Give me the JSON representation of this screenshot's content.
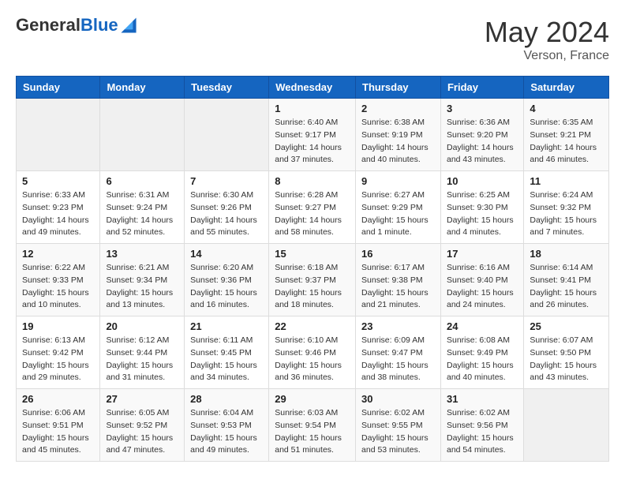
{
  "logo": {
    "general": "General",
    "blue": "Blue"
  },
  "header": {
    "month": "May 2024",
    "location": "Verson, France"
  },
  "weekdays": [
    "Sunday",
    "Monday",
    "Tuesday",
    "Wednesday",
    "Thursday",
    "Friday",
    "Saturday"
  ],
  "weeks": [
    [
      {
        "day": "",
        "sunrise": "",
        "sunset": "",
        "daylight": ""
      },
      {
        "day": "",
        "sunrise": "",
        "sunset": "",
        "daylight": ""
      },
      {
        "day": "",
        "sunrise": "",
        "sunset": "",
        "daylight": ""
      },
      {
        "day": "1",
        "sunrise": "Sunrise: 6:40 AM",
        "sunset": "Sunset: 9:17 PM",
        "daylight": "Daylight: 14 hours and 37 minutes."
      },
      {
        "day": "2",
        "sunrise": "Sunrise: 6:38 AM",
        "sunset": "Sunset: 9:19 PM",
        "daylight": "Daylight: 14 hours and 40 minutes."
      },
      {
        "day": "3",
        "sunrise": "Sunrise: 6:36 AM",
        "sunset": "Sunset: 9:20 PM",
        "daylight": "Daylight: 14 hours and 43 minutes."
      },
      {
        "day": "4",
        "sunrise": "Sunrise: 6:35 AM",
        "sunset": "Sunset: 9:21 PM",
        "daylight": "Daylight: 14 hours and 46 minutes."
      }
    ],
    [
      {
        "day": "5",
        "sunrise": "Sunrise: 6:33 AM",
        "sunset": "Sunset: 9:23 PM",
        "daylight": "Daylight: 14 hours and 49 minutes."
      },
      {
        "day": "6",
        "sunrise": "Sunrise: 6:31 AM",
        "sunset": "Sunset: 9:24 PM",
        "daylight": "Daylight: 14 hours and 52 minutes."
      },
      {
        "day": "7",
        "sunrise": "Sunrise: 6:30 AM",
        "sunset": "Sunset: 9:26 PM",
        "daylight": "Daylight: 14 hours and 55 minutes."
      },
      {
        "day": "8",
        "sunrise": "Sunrise: 6:28 AM",
        "sunset": "Sunset: 9:27 PM",
        "daylight": "Daylight: 14 hours and 58 minutes."
      },
      {
        "day": "9",
        "sunrise": "Sunrise: 6:27 AM",
        "sunset": "Sunset: 9:29 PM",
        "daylight": "Daylight: 15 hours and 1 minute."
      },
      {
        "day": "10",
        "sunrise": "Sunrise: 6:25 AM",
        "sunset": "Sunset: 9:30 PM",
        "daylight": "Daylight: 15 hours and 4 minutes."
      },
      {
        "day": "11",
        "sunrise": "Sunrise: 6:24 AM",
        "sunset": "Sunset: 9:32 PM",
        "daylight": "Daylight: 15 hours and 7 minutes."
      }
    ],
    [
      {
        "day": "12",
        "sunrise": "Sunrise: 6:22 AM",
        "sunset": "Sunset: 9:33 PM",
        "daylight": "Daylight: 15 hours and 10 minutes."
      },
      {
        "day": "13",
        "sunrise": "Sunrise: 6:21 AM",
        "sunset": "Sunset: 9:34 PM",
        "daylight": "Daylight: 15 hours and 13 minutes."
      },
      {
        "day": "14",
        "sunrise": "Sunrise: 6:20 AM",
        "sunset": "Sunset: 9:36 PM",
        "daylight": "Daylight: 15 hours and 16 minutes."
      },
      {
        "day": "15",
        "sunrise": "Sunrise: 6:18 AM",
        "sunset": "Sunset: 9:37 PM",
        "daylight": "Daylight: 15 hours and 18 minutes."
      },
      {
        "day": "16",
        "sunrise": "Sunrise: 6:17 AM",
        "sunset": "Sunset: 9:38 PM",
        "daylight": "Daylight: 15 hours and 21 minutes."
      },
      {
        "day": "17",
        "sunrise": "Sunrise: 6:16 AM",
        "sunset": "Sunset: 9:40 PM",
        "daylight": "Daylight: 15 hours and 24 minutes."
      },
      {
        "day": "18",
        "sunrise": "Sunrise: 6:14 AM",
        "sunset": "Sunset: 9:41 PM",
        "daylight": "Daylight: 15 hours and 26 minutes."
      }
    ],
    [
      {
        "day": "19",
        "sunrise": "Sunrise: 6:13 AM",
        "sunset": "Sunset: 9:42 PM",
        "daylight": "Daylight: 15 hours and 29 minutes."
      },
      {
        "day": "20",
        "sunrise": "Sunrise: 6:12 AM",
        "sunset": "Sunset: 9:44 PM",
        "daylight": "Daylight: 15 hours and 31 minutes."
      },
      {
        "day": "21",
        "sunrise": "Sunrise: 6:11 AM",
        "sunset": "Sunset: 9:45 PM",
        "daylight": "Daylight: 15 hours and 34 minutes."
      },
      {
        "day": "22",
        "sunrise": "Sunrise: 6:10 AM",
        "sunset": "Sunset: 9:46 PM",
        "daylight": "Daylight: 15 hours and 36 minutes."
      },
      {
        "day": "23",
        "sunrise": "Sunrise: 6:09 AM",
        "sunset": "Sunset: 9:47 PM",
        "daylight": "Daylight: 15 hours and 38 minutes."
      },
      {
        "day": "24",
        "sunrise": "Sunrise: 6:08 AM",
        "sunset": "Sunset: 9:49 PM",
        "daylight": "Daylight: 15 hours and 40 minutes."
      },
      {
        "day": "25",
        "sunrise": "Sunrise: 6:07 AM",
        "sunset": "Sunset: 9:50 PM",
        "daylight": "Daylight: 15 hours and 43 minutes."
      }
    ],
    [
      {
        "day": "26",
        "sunrise": "Sunrise: 6:06 AM",
        "sunset": "Sunset: 9:51 PM",
        "daylight": "Daylight: 15 hours and 45 minutes."
      },
      {
        "day": "27",
        "sunrise": "Sunrise: 6:05 AM",
        "sunset": "Sunset: 9:52 PM",
        "daylight": "Daylight: 15 hours and 47 minutes."
      },
      {
        "day": "28",
        "sunrise": "Sunrise: 6:04 AM",
        "sunset": "Sunset: 9:53 PM",
        "daylight": "Daylight: 15 hours and 49 minutes."
      },
      {
        "day": "29",
        "sunrise": "Sunrise: 6:03 AM",
        "sunset": "Sunset: 9:54 PM",
        "daylight": "Daylight: 15 hours and 51 minutes."
      },
      {
        "day": "30",
        "sunrise": "Sunrise: 6:02 AM",
        "sunset": "Sunset: 9:55 PM",
        "daylight": "Daylight: 15 hours and 53 minutes."
      },
      {
        "day": "31",
        "sunrise": "Sunrise: 6:02 AM",
        "sunset": "Sunset: 9:56 PM",
        "daylight": "Daylight: 15 hours and 54 minutes."
      },
      {
        "day": "",
        "sunrise": "",
        "sunset": "",
        "daylight": ""
      }
    ]
  ]
}
